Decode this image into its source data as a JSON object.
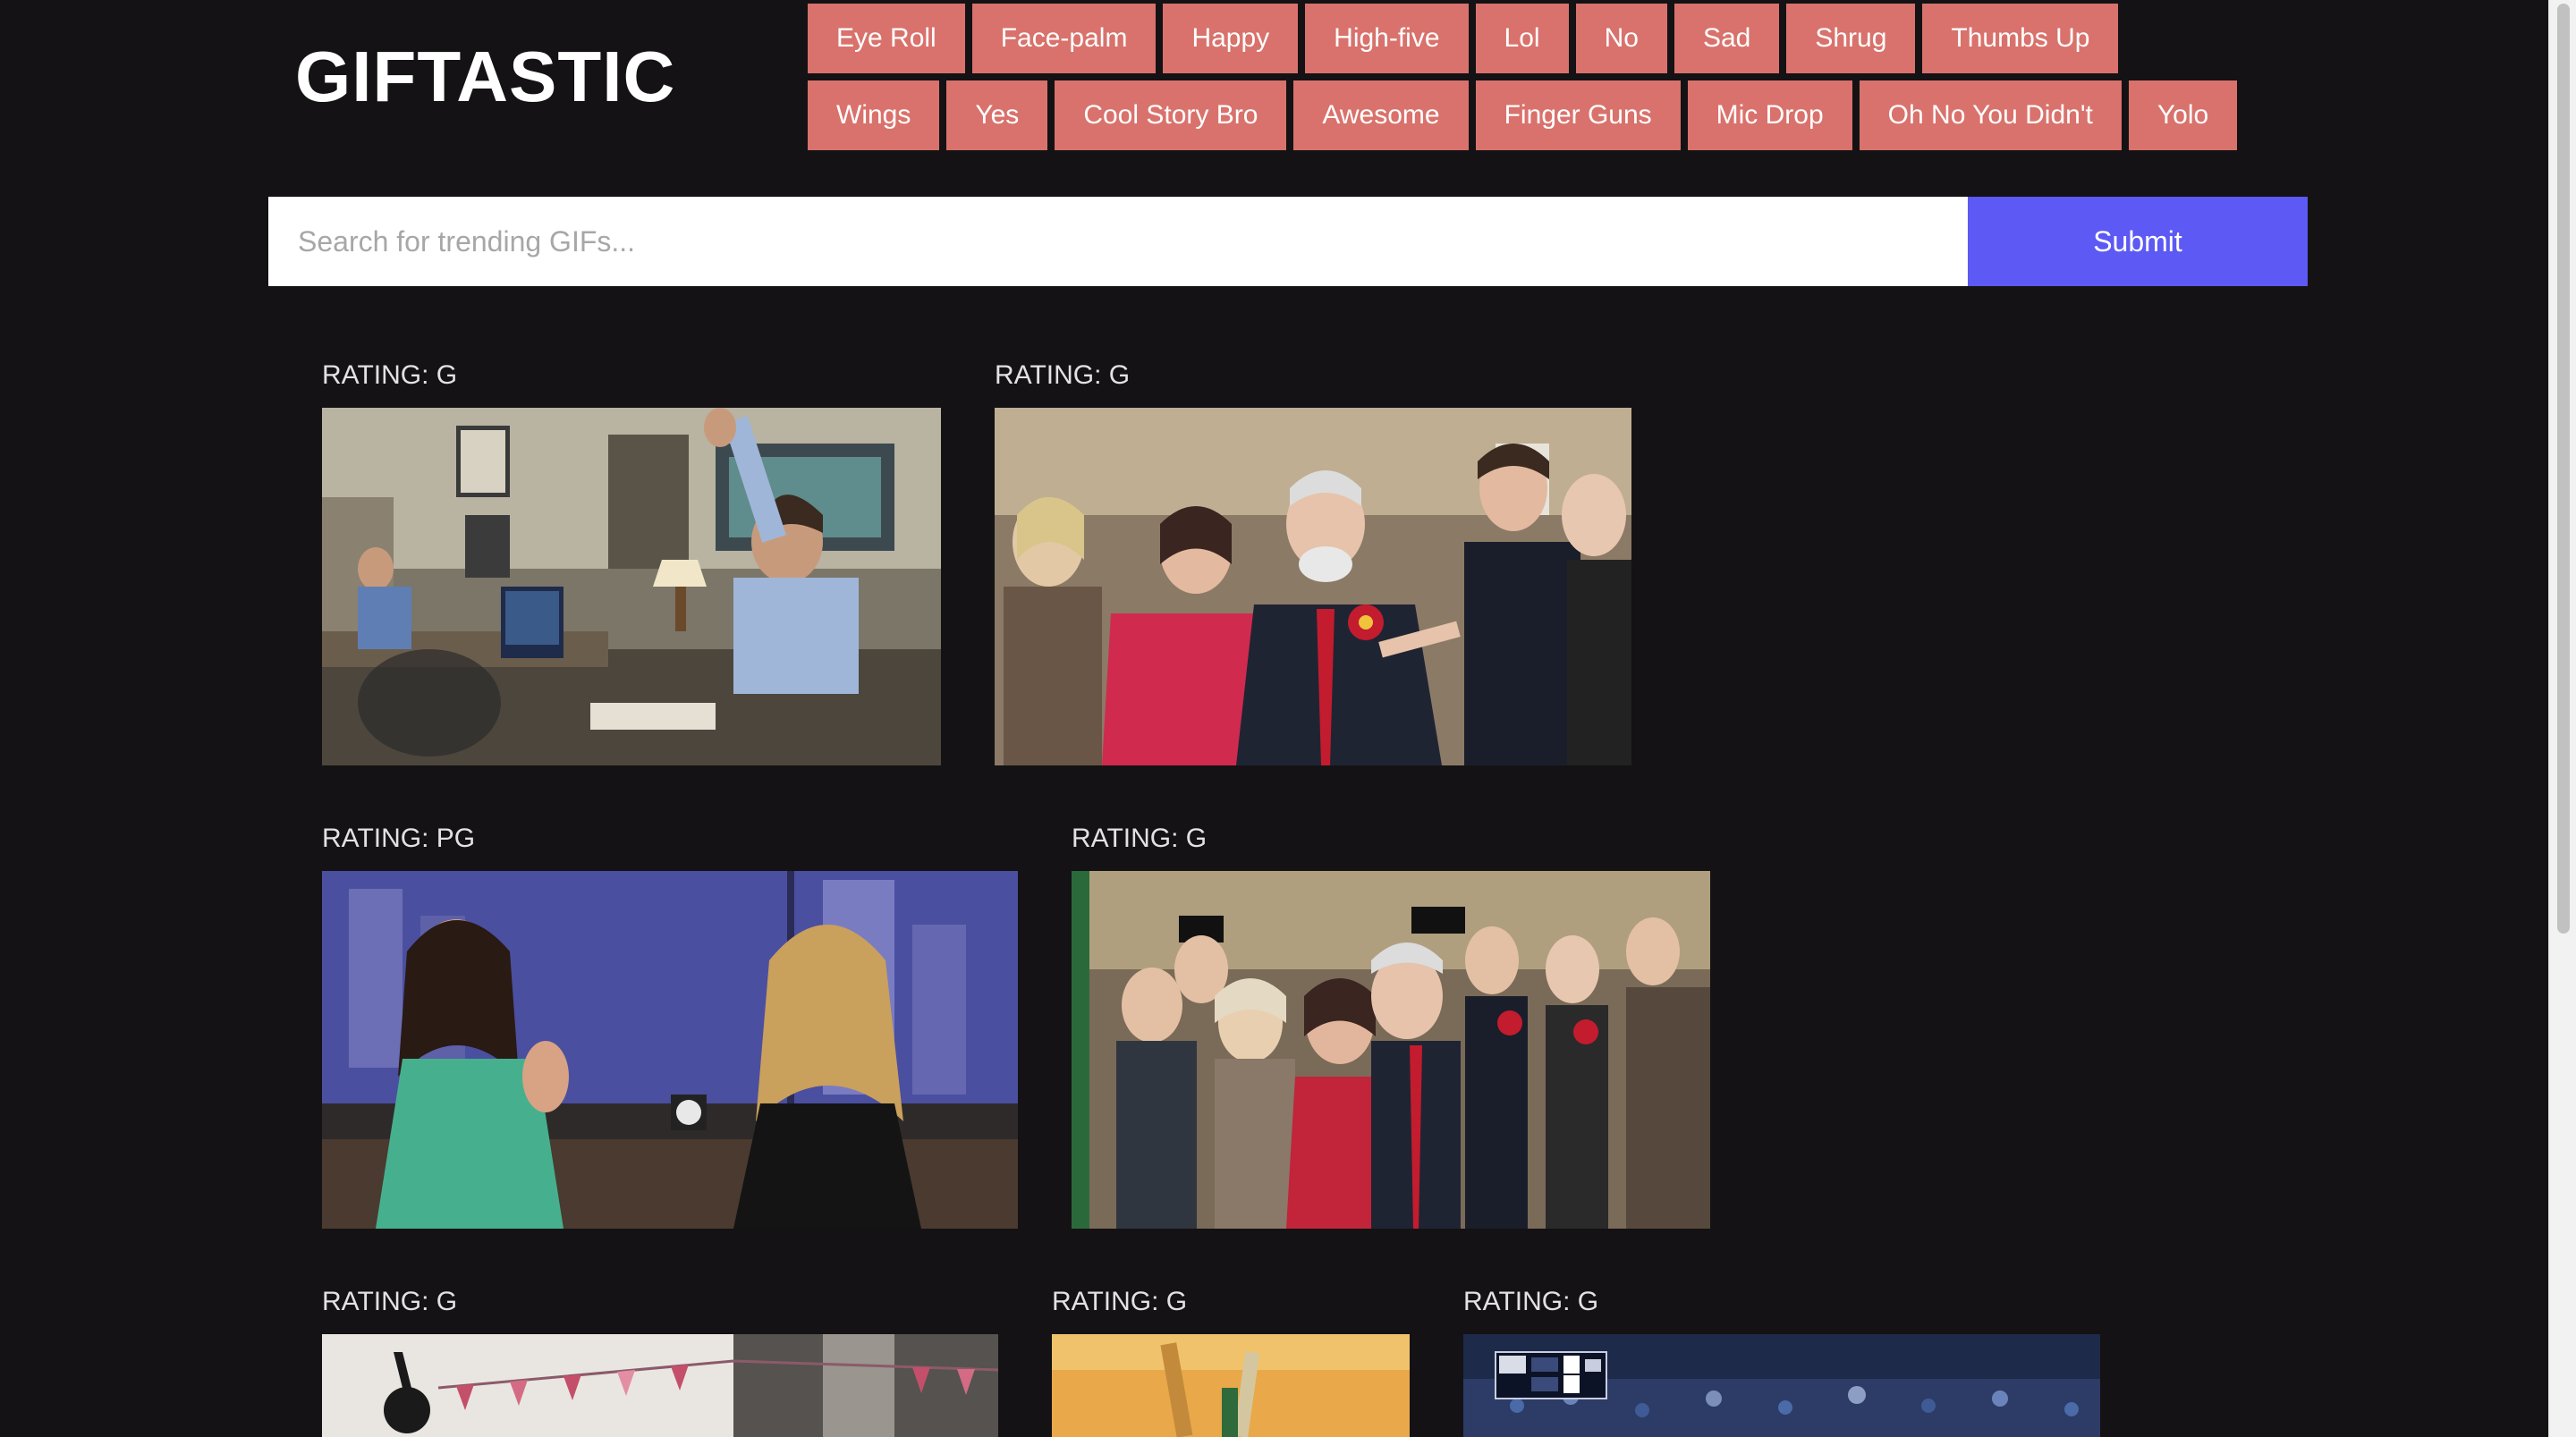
{
  "header": {
    "logo": "GIFTASTIC"
  },
  "topic_buttons": {
    "row1": [
      "Eye Roll",
      "Face-palm",
      "Happy",
      "High-five",
      "Lol",
      "No",
      "Sad",
      "Shrug",
      "Thumbs Up"
    ],
    "row2": [
      "Wings",
      "Yes",
      "Cool Story Bro",
      "Awesome",
      "Finger Guns",
      "Mic Drop",
      "Oh No You Didn't",
      "Yolo"
    ]
  },
  "search": {
    "placeholder": "Search for trending GIFs...",
    "value": "",
    "submit_label": "Submit"
  },
  "gifs": [
    {
      "rating": "RATING: G"
    },
    {
      "rating": "RATING: G"
    },
    {
      "rating": "RATING: PG"
    },
    {
      "rating": "RATING: G"
    },
    {
      "rating": "RATING: G"
    },
    {
      "rating": "RATING: G"
    },
    {
      "rating": "RATING: G"
    }
  ],
  "colors": {
    "background": "#141214",
    "topic_button": "#d9726c",
    "submit_button": "#5c59f4"
  }
}
